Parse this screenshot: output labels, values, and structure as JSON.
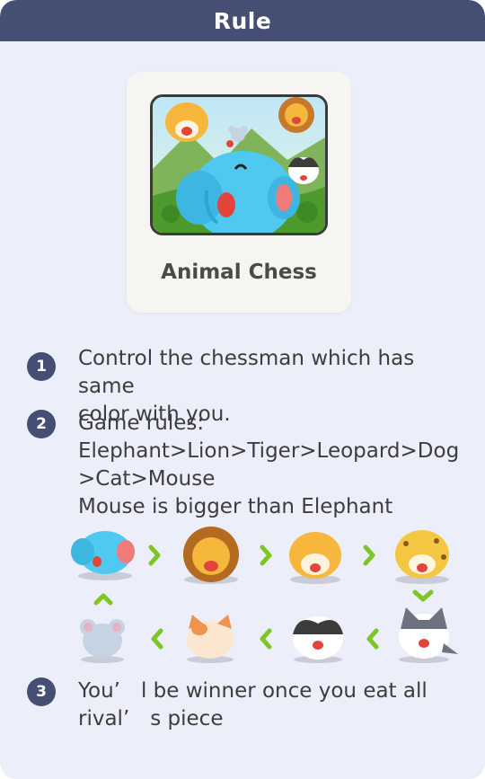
{
  "header": {
    "title": "Rule"
  },
  "game_card": {
    "name": "Animal Chess"
  },
  "rules": [
    {
      "number": "1",
      "lines": [
        "Control the chessman which has same",
        "color with you."
      ]
    },
    {
      "number": "2",
      "lines": [
        "Game rules:",
        "Elephant>Lion>Tiger>Leopard>Dog",
        ">Cat>Mouse",
        "Mouse is bigger than Elephant"
      ]
    },
    {
      "number": "3",
      "lines": [
        "You’　l be winner once you eat all",
        "rival’　s piece"
      ]
    }
  ],
  "hierarchy": [
    "Elephant",
    "Lion",
    "Tiger",
    "Leopard",
    "Dog",
    "Cat",
    "Mouse"
  ],
  "colors": {
    "header": "#454f73",
    "panel": "#eceef9",
    "arrow": "#7ec526"
  }
}
